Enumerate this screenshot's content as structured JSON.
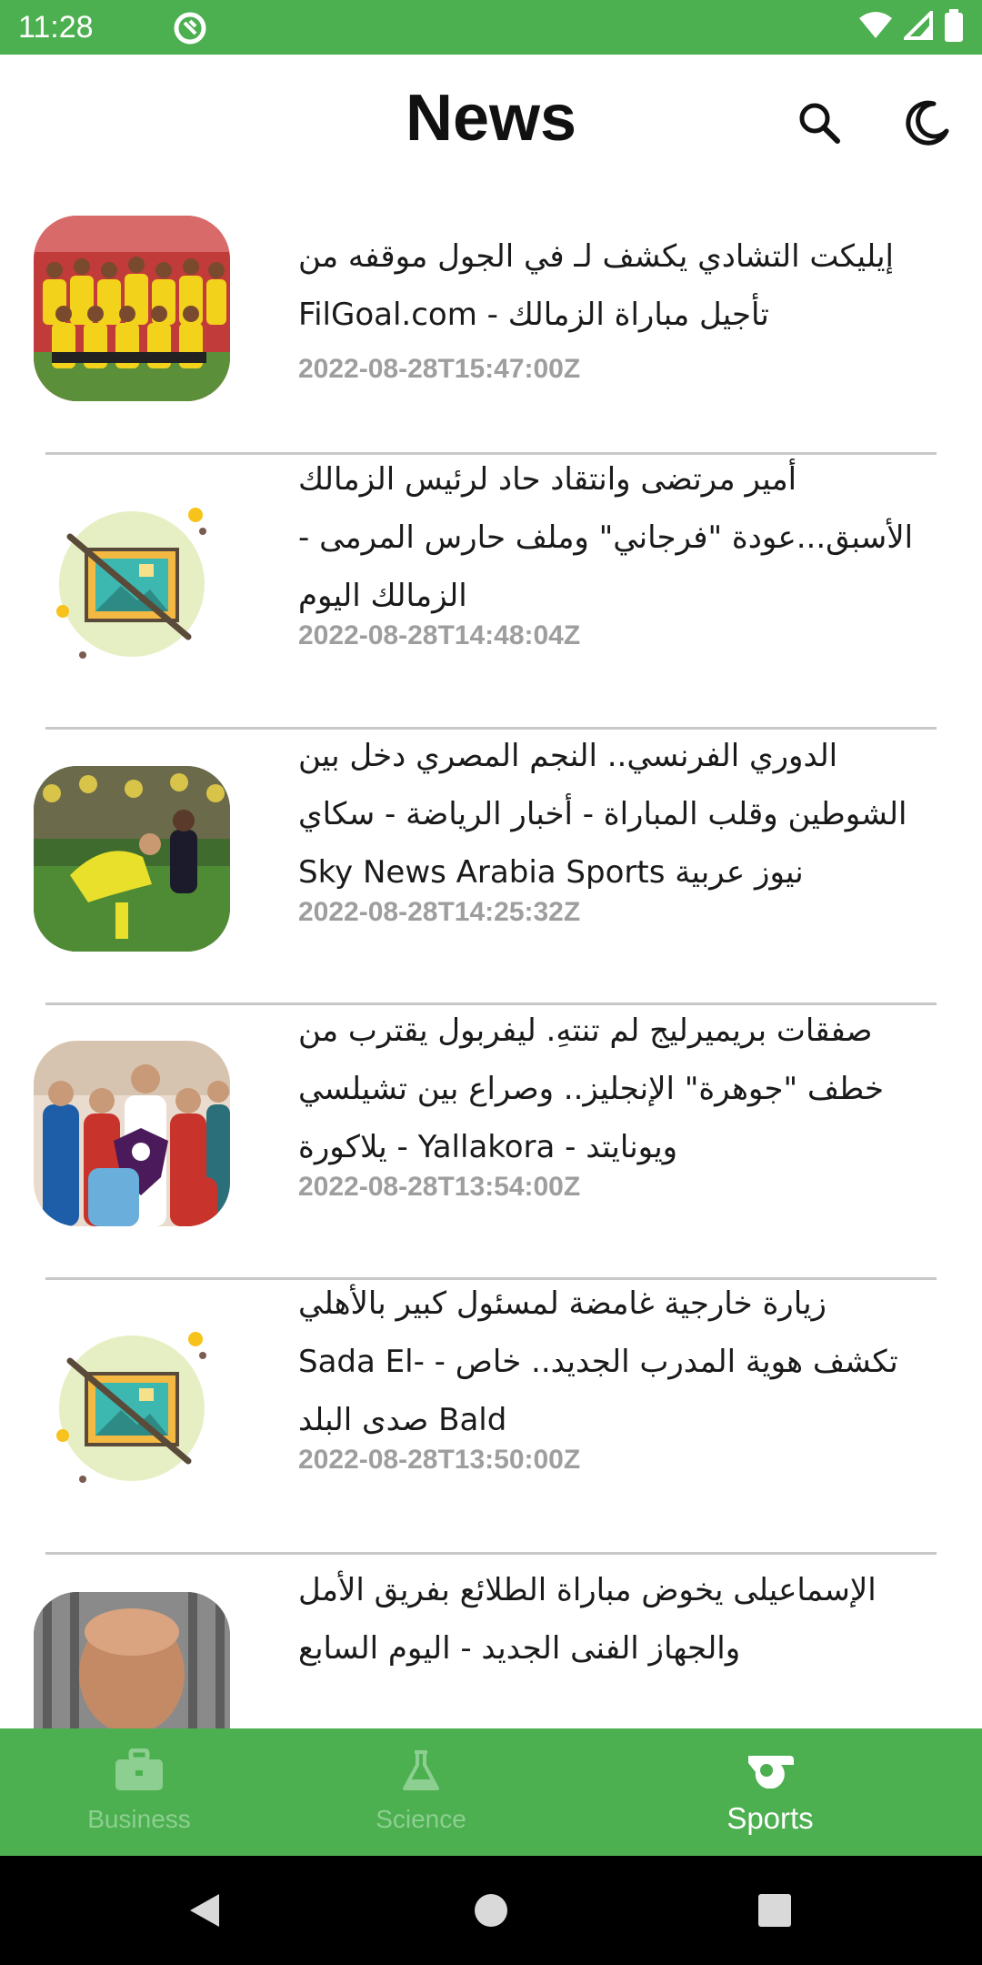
{
  "status_bar": {
    "time": "11:28"
  },
  "app_bar": {
    "title": "News"
  },
  "articles": [
    {
      "title": "إيليكت التشادي يكشف لـ في الجول موقفه من تأجيل مباراة الزمالك - FilGoal.com",
      "date": "2022-08-28T15:47:00Z",
      "thumbnail": "team-photo"
    },
    {
      "title": "أمير مرتضى وانتقاد حاد لرئيس الزمالك الأسبق...عودة \"فرجاني\" وملف حارس المرمى - الزمالك اليوم",
      "date": "2022-08-28T14:48:04Z",
      "thumbnail": "image-placeholder-icon"
    },
    {
      "title": "الدوري الفرنسي.. النجم المصري دخل بين الشوطين وقلب المباراة - أخبار الرياضة - سكاي نيوز عربية Sky News Arabia Sports",
      "date": "2022-08-28T14:25:32Z",
      "thumbnail": "football-action-photo"
    },
    {
      "title": "صفقات بريميرليج لم تنتهِ. ليفربول يقترب من خطف \"جوهرة\" الإنجليز.. وصراع بين تشيلسي ويونايتد - Yallakora - يلاكورة",
      "date": "2022-08-28T13:54:00Z",
      "thumbnail": "premier-league-players-photo"
    },
    {
      "title": "زيارة خارجية غامضة لمسئول كبير بالأهلي تكشف هوية المدرب الجديد.. خاص - Sada El-Bald صدى البلد",
      "date": "2022-08-28T13:50:00Z",
      "thumbnail": "image-placeholder-icon"
    },
    {
      "title": "الإسماعيلى يخوض مباراة الطلائع بفريق الأمل والجهاز الفنى الجديد - اليوم السابع",
      "date": "",
      "thumbnail": "coach-portrait-photo"
    }
  ],
  "bottom_nav": {
    "items": [
      {
        "label": "Business",
        "icon": "briefcase-icon",
        "active": false
      },
      {
        "label": "Science",
        "icon": "flask-icon",
        "active": false
      },
      {
        "label": "Sports",
        "icon": "whistle-icon",
        "active": true
      }
    ]
  },
  "colors": {
    "primary": "#4caf50",
    "nav_inactive": "#8dcf90",
    "date_text": "#9e9e9e",
    "divider": "#c8c8c8"
  }
}
